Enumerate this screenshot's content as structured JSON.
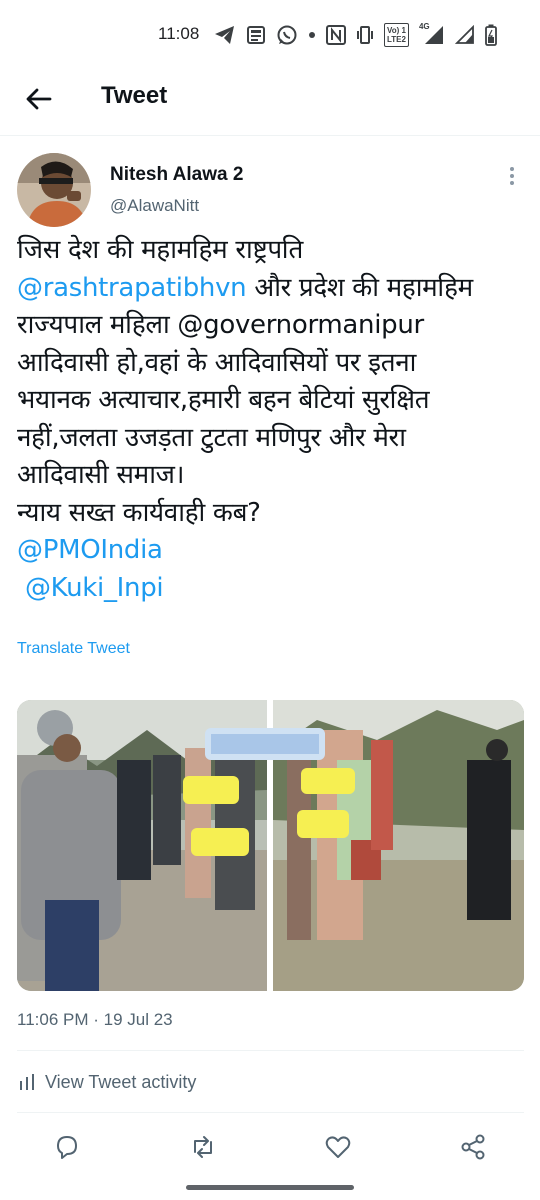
{
  "status_bar": {
    "time": "11:08",
    "icons": [
      "telegram-icon",
      "news-icon",
      "whatsapp-icon",
      "dot-icon",
      "nfc-icon",
      "vibrate-icon",
      "volte-icon",
      "4g-signal-icon",
      "signal-icon",
      "battery-icon"
    ],
    "volte_line1": "Vo) 1",
    "volte_line2": "LTE2",
    "net_label": "4G"
  },
  "header": {
    "title": "Tweet"
  },
  "tweet": {
    "author_name": "Nitesh Alawa 2",
    "author_handle": "@AlawaNitt",
    "text": {
      "l1": "जिस देश की महामहिम राष्ट्रपति",
      "l2_mention": "@rashtrapatibhvn",
      "l2_rest": " और प्रदेश की महामहिम",
      "l3": "राज्यपाल महिला @governormanipur",
      "l4": "आदिवासी हो,वहां के आदिवासियों पर इतना",
      "l5": "भयानक अत्याचार,हमारी बहन बेटियां सुरक्षित",
      "l6": "नहीं,जलता उजड़ता टुटता मणिपुर और मेरा",
      "l7": "आदिवासी समाज।",
      "l8": "न्याय सख्त कार्यवाही कब?",
      "l9_mention": "@PMOIndia",
      "l10_mention": " @Kuki_Inpi"
    },
    "translate_label": "Translate Tweet",
    "timestamp": "11:06 PM · 19 Jul 23",
    "activity_label": "View Tweet activity"
  },
  "actions": [
    "reply-icon",
    "retweet-icon",
    "like-icon",
    "share-icon"
  ],
  "colors": {
    "link": "#1d9bf0",
    "secondary_text": "#536471",
    "divider": "#eff3f4",
    "censor_bar": "#f6ef52"
  }
}
